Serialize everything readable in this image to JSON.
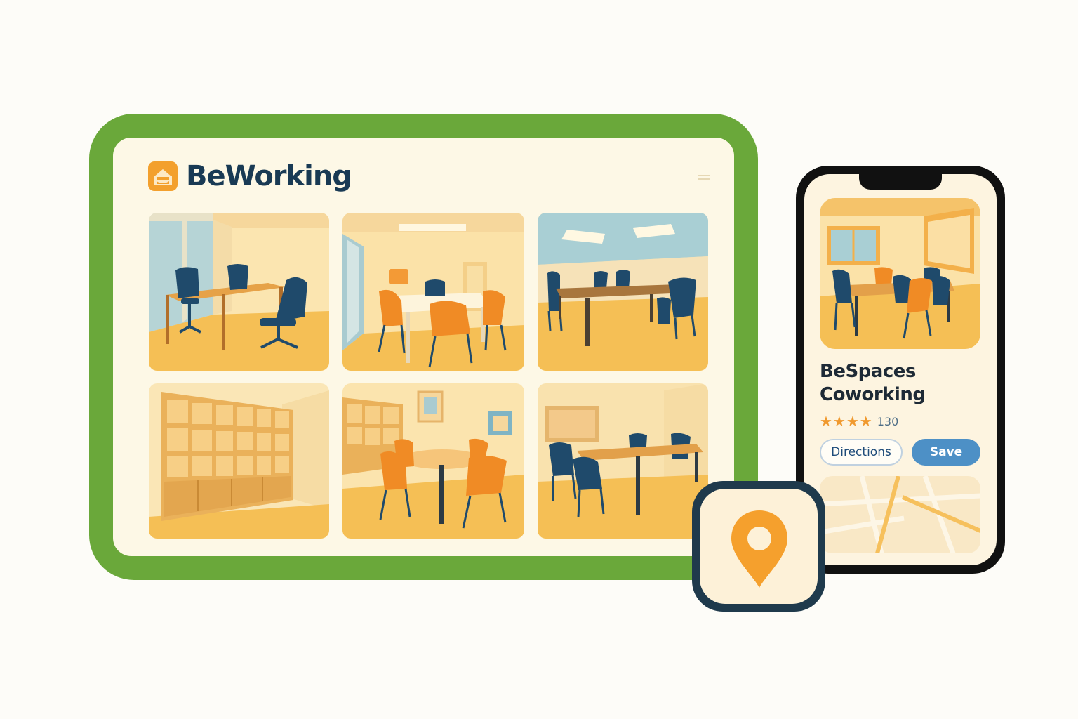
{
  "brand": {
    "name": "BeWorking",
    "logo": "house-logo-icon"
  },
  "tablet": {
    "menu_icon": "hamburger-menu-icon",
    "tiles": [
      {
        "id": "meeting-room-blue-chairs"
      },
      {
        "id": "meeting-room-orange-chairs"
      },
      {
        "id": "conference-room-long-table"
      },
      {
        "id": "storage-shelves-room"
      },
      {
        "id": "round-table-room"
      },
      {
        "id": "whiteboard-meeting-room"
      }
    ]
  },
  "phone": {
    "listing": {
      "name": "BeSpaces Coworking",
      "stars": "★★★★",
      "review_count": "130"
    },
    "buttons": {
      "directions": "Directions",
      "save": "Save"
    }
  },
  "app_icon": {
    "icon": "location-pin-icon"
  },
  "colors": {
    "frame_green": "#6aa83a",
    "brand_orange": "#f3a02d",
    "navy": "#193a54",
    "chair_blue": "#1f4a6b",
    "chair_orange": "#f08b25",
    "button_blue": "#4d90c6"
  }
}
